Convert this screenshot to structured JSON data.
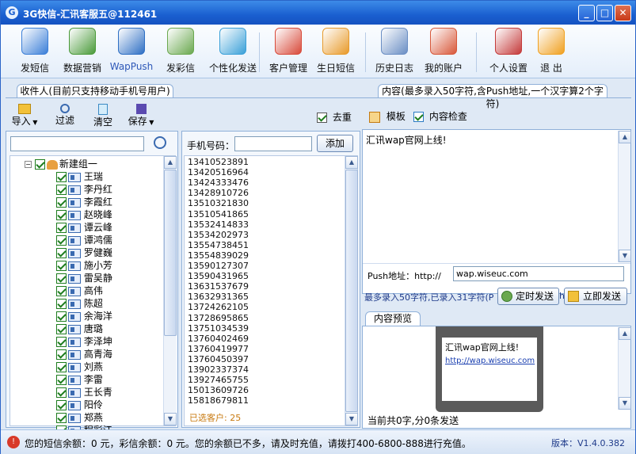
{
  "window": {
    "title": "3G快信-汇讯客服五@112461"
  },
  "toolbar": {
    "items": [
      {
        "label": "发短信",
        "icon": "sms-send-icon",
        "color": "#3b7fd8"
      },
      {
        "label": "数据营销",
        "icon": "database-icon",
        "color": "#4a9a3a"
      },
      {
        "label": "WapPush",
        "icon": "wap-push-icon",
        "color": "#2e6fc4"
      },
      {
        "label": "发彩信",
        "icon": "mms-icon",
        "color": "#6aa84f"
      },
      {
        "label": "个性化发送",
        "icon": "personalized-send-icon",
        "color": "#3aa0d8"
      },
      {
        "label": "客户管理",
        "icon": "customers-icon",
        "color": "#d84a3a"
      },
      {
        "label": "生日短信",
        "icon": "birthday-cake-icon",
        "color": "#e89a2a"
      },
      {
        "label": "历史日志",
        "icon": "history-log-icon",
        "color": "#6a8ec4"
      },
      {
        "label": "我的账户",
        "icon": "account-chart-icon",
        "color": "#d8583a"
      },
      {
        "label": "个人设置",
        "icon": "settings-tools-icon",
        "color": "#c43a3a"
      },
      {
        "label": "退 出",
        "icon": "exit-icon",
        "color": "#f0a020"
      }
    ]
  },
  "recipients": {
    "tab_label": "收件人(目前只支持移动手机号用户)",
    "actions": {
      "import": "导入",
      "filter": "过滤",
      "clear": "清空",
      "save": "保存"
    },
    "dedup_label": "去重",
    "search_placeholder": "",
    "group_name": "新建组一",
    "contacts": [
      "王瑞",
      "李丹红",
      "李霞红",
      "赵晓峰",
      "谭云峰",
      "谭鸿儒",
      "罗健巍",
      "施小芳",
      "雷吴静",
      "高伟",
      "陈超",
      "余海洋",
      "唐璐",
      "李泽坤",
      "高青海",
      "刘燕",
      "李雷",
      "王长青",
      "阳伶",
      "郑燕",
      "程彩江"
    ]
  },
  "phones": {
    "label": "手机号码：",
    "input_value": "",
    "add_button": "添加",
    "numbers": [
      "13410523891",
      "13420516964",
      "13424333476",
      "13428910726",
      "13510321830",
      "13510541865",
      "13532414833",
      "13534202973",
      "13554738451",
      "13554839029",
      "13590127307",
      "13590431965",
      "13631537679",
      "13632931365",
      "13724262105",
      "13728695865",
      "13751034539",
      "13760402469",
      "13760419977",
      "13760450397",
      "13902337374",
      "13927465755",
      "15013609726",
      "15818679811"
    ],
    "selected_count": "已选客户: 25"
  },
  "content": {
    "tab_label": "内容(最多录入50字符,含Push地址,一个汉字算2个字符)",
    "template_label": "模板",
    "check_label": "内容检查",
    "message": "汇讯wap官网上线!",
    "push_label": "Push地址：http://",
    "push_value": "wap.wiseuc.com",
    "counter": "最多录入50字符,已录入31字符(P",
    "counter_tail": "h",
    "schedule_button": "定时发送",
    "send_button": "立即发送"
  },
  "preview": {
    "tab_label": "内容预览",
    "message": "汇讯wap官网上线!",
    "link": "http://wap.wiseuc.com",
    "summary": "当前共0字,分0条发送"
  },
  "statusbar": {
    "message": "您的短信余额：0 元，彩信余额：0 元。您的余额已不多，请及时充值，请拨打400-6800-888进行充值。",
    "version": "版本：V1.4.0.382"
  }
}
